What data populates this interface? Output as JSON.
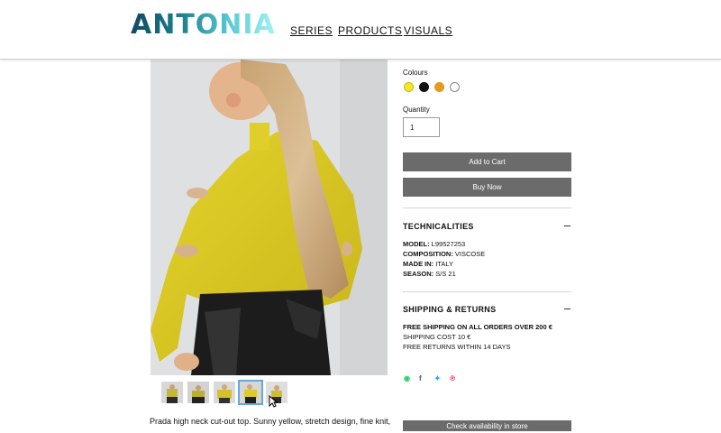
{
  "header": {
    "logo": "ANTONIA",
    "nav": [
      "SERIES",
      "PRODUCTS",
      "VISUALS"
    ]
  },
  "product": {
    "description": "Prada high neck cut-out top. Sunny yellow, stretch design, fine knit,",
    "thumbnails_count": 5,
    "active_thumbnail": 4
  },
  "options": {
    "colours_label": "Colours",
    "colours": [
      "#f5e62a",
      "#111111",
      "#e39a1d",
      "#ffffff"
    ],
    "quantity_label": "Quantity",
    "quantity_value": "1"
  },
  "actions": {
    "add_to_cart": "Add to Cart",
    "buy_now": "Buy Now",
    "check_store": "Check availability in store"
  },
  "technicalities": {
    "title": "TECHNICALITIES",
    "rows": [
      {
        "key": "MODEL:",
        "value": " L99527253"
      },
      {
        "key": "COMPOSITION:",
        "value": " VISCOSE"
      },
      {
        "key": "MADE IN:",
        "value": " ITALY"
      },
      {
        "key": "SEASON:",
        "value": " S/S 21"
      }
    ]
  },
  "shipping": {
    "title": "SHIPPING & RETURNS",
    "lines": [
      "FREE SHIPPING ON ALL ORDERS OVER 200 €",
      "SHIPPING COST 10 €",
      "FREE RETURNS WITHIN 14 DAYS"
    ]
  },
  "share": {
    "icons": [
      "whatsapp-icon",
      "facebook-icon",
      "twitter-icon",
      "pinterest-icon"
    ],
    "glyphs": [
      "◉",
      "f",
      "✦",
      "℗"
    ],
    "colors": [
      "#25d366",
      "#3b5998",
      "#1da1f2",
      "#e60023"
    ]
  }
}
